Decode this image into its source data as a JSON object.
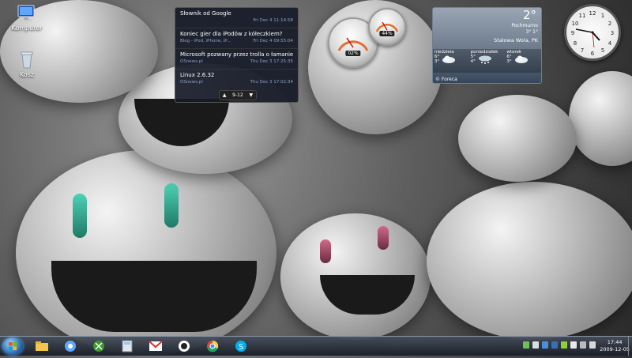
{
  "desktop": {
    "icons": [
      {
        "label": "Komputer",
        "icon": "computer-icon"
      },
      {
        "label": "Kosz",
        "icon": "recycle-bin-icon"
      }
    ]
  },
  "rss_gadget": {
    "items": [
      {
        "title": "Słownik od Google",
        "source": "",
        "date": "Fri Dec 4 11:14:58"
      },
      {
        "title": "Koniec gier dla iPodów z kółeczkiem?",
        "source": "Blog - iPod, iPhone, iP...",
        "date": "Fri Dec 4 09:55:04"
      },
      {
        "title": "Microsoft pozwany przez trolla o łamanie ...",
        "source": "OSnews.pl",
        "date": "Thu Dec 3 17:25:35"
      },
      {
        "title": "Linux 2.6.32",
        "source": "OSnews.pl",
        "date": "Thu Dec 3 17:02:34"
      }
    ],
    "pager": "9-12"
  },
  "meters": {
    "cpu_percent": "02%",
    "memory_percent": "44%"
  },
  "weather": {
    "temperature": "2°",
    "condition": "Pochmurno",
    "high_low": "3° 1°",
    "location": "Stalowa Wola, PK",
    "days": [
      {
        "name": "niedziela",
        "high": "6°",
        "low": "3°",
        "icon": "cloud-icon"
      },
      {
        "name": "poniedziałek",
        "high": "5°",
        "low": "4°",
        "icon": "snow-cloud-icon"
      },
      {
        "name": "wtorek",
        "high": "6°",
        "low": "3°",
        "icon": "cloud-icon"
      }
    ],
    "provider": "© Foreca"
  },
  "taskbar": {
    "apps": [
      "explorer-icon",
      "itunes-icon",
      "xbox-icon",
      "calculator-icon",
      "gmail-icon",
      "photo-viewer-icon",
      "chrome-icon",
      "skype-icon"
    ],
    "time": "17:44",
    "date": "2009-12-05"
  },
  "colors": {
    "accent": "#2a6fb6",
    "rss_bg": "#161a28",
    "rss_meta": "#8aa0c8"
  }
}
